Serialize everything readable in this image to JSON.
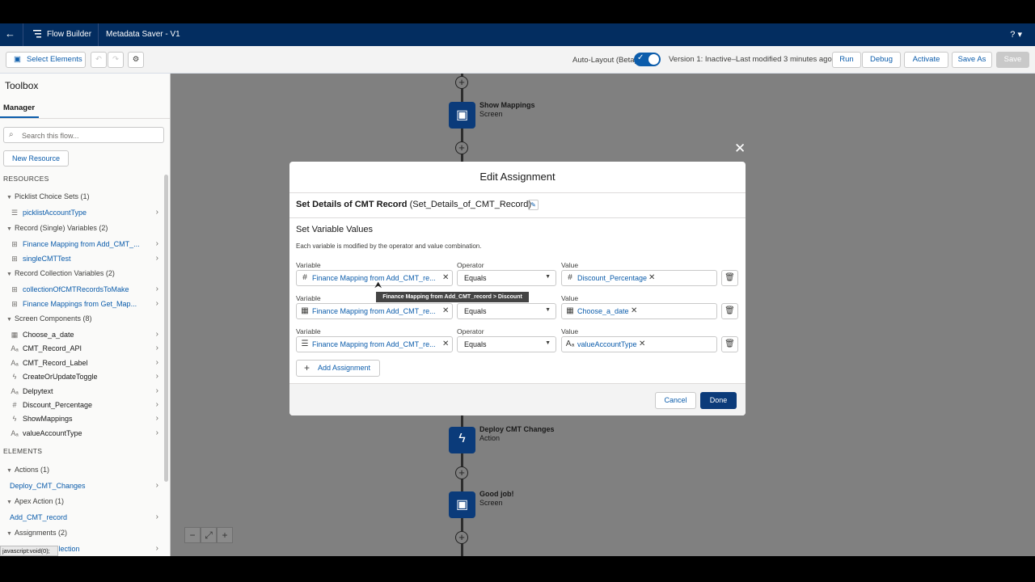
{
  "header": {
    "back_icon": "back-arrow-icon",
    "app_name": "Flow Builder",
    "flow_title": "Metadata Saver - V1",
    "help_label": "? ▾"
  },
  "toolbar": {
    "select_elements": "Select Elements",
    "auto_layout_label": "Auto-Layout (Beta)",
    "version_status": "Version 1: Inactive–Last modified 3 minutes ago",
    "run": "Run",
    "debug": "Debug",
    "activate": "Activate",
    "save_as": "Save As",
    "save": "Save"
  },
  "sidebar": {
    "title": "Toolbox",
    "tab": "Manager",
    "search_placeholder": "Search this flow...",
    "new_resource": "New Resource",
    "resources_heading": "RESOURCES",
    "elements_heading": "ELEMENTS",
    "groups": [
      {
        "label": "Picklist Choice Sets (1)",
        "items": [
          {
            "label": "picklistAccountType",
            "icon": "list-icon",
            "link": true
          }
        ]
      },
      {
        "label": "Record (Single) Variables (2)",
        "items": [
          {
            "label": "Finance Mapping from Add_CMT_...",
            "icon": "record-icon",
            "link": true
          },
          {
            "label": "singleCMTTest",
            "icon": "record-icon",
            "link": true
          }
        ]
      },
      {
        "label": "Record Collection Variables (2)",
        "items": [
          {
            "label": "collectionOfCMTRecordsToMake",
            "icon": "record-icon",
            "link": true
          },
          {
            "label": "Finance Mappings from Get_Map...",
            "icon": "record-icon",
            "link": true
          }
        ]
      },
      {
        "label": "Screen Components (8)",
        "items": [
          {
            "label": "Choose_a_date",
            "icon": "calendar-icon",
            "link": false
          },
          {
            "label": "CMT_Record_API",
            "icon": "text-icon",
            "link": false
          },
          {
            "label": "CMT_Record_Label",
            "icon": "text-icon",
            "link": false
          },
          {
            "label": "CreateOrUpdateToggle",
            "icon": "toggle-icon",
            "link": false
          },
          {
            "label": "Delpytext",
            "icon": "text-icon",
            "link": false
          },
          {
            "label": "Discount_Percentage",
            "icon": "number-icon",
            "link": false
          },
          {
            "label": "ShowMappings",
            "icon": "toggle-icon",
            "link": false
          },
          {
            "label": "valueAccountType",
            "icon": "text-icon",
            "link": false
          }
        ]
      }
    ],
    "element_groups": [
      {
        "label": "Actions (1)",
        "items": [
          {
            "label": "Deploy_CMT_Changes"
          }
        ]
      },
      {
        "label": "Apex Action (1)",
        "items": [
          {
            "label": "Add_CMT_record"
          }
        ]
      },
      {
        "label": "Assignments (2)",
        "items": [
          {
            "label": "...ollection"
          }
        ]
      }
    ]
  },
  "canvas": {
    "nodes": [
      {
        "name": "Show Mappings",
        "type": "Screen",
        "icon": "screen-icon"
      },
      {
        "name": "Deploy CMT Changes",
        "type": "Action",
        "icon": "action-icon"
      },
      {
        "name": "Good job!",
        "type": "Screen",
        "icon": "screen-icon"
      }
    ]
  },
  "modal": {
    "title": "Edit Assignment",
    "label_bold": "Set Details of CMT Record",
    "label_api": "(Set_Details_of_CMT_Record)",
    "section_title": "Set Variable Values",
    "description": "Each variable is modified by the operator and value combination.",
    "variable_label": "Variable",
    "operator_label": "Operator",
    "value_label": "Value",
    "rows": [
      {
        "variable": "Finance Mapping from Add_CMT_re...",
        "variable_icon": "number-icon",
        "operator": "Equals",
        "value": "Discount_Percentage",
        "value_icon": "number-icon"
      },
      {
        "variable": "Finance Mapping from Add_CMT_re...",
        "variable_icon": "calendar-icon",
        "operator": "Equals",
        "value": "Choose_a_date",
        "value_icon": "calendar-icon"
      },
      {
        "variable": "Finance Mapping from Add_CMT_re...",
        "variable_icon": "list-icon",
        "operator": "Equals",
        "value": "valueAccountType",
        "value_icon": "text-icon"
      }
    ],
    "tooltip": "Finance Mapping from Add_CMT_record > Discount",
    "add_assignment": "Add Assignment",
    "cancel": "Cancel",
    "done": "Done"
  },
  "status_bar": "javascript:void(0);",
  "colors": {
    "brand": "#032d60",
    "accent": "#0b5cab",
    "done": "#0b3b7a"
  }
}
